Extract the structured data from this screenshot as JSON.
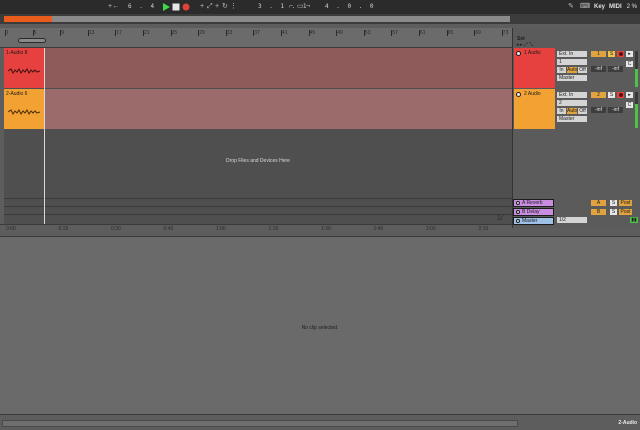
{
  "transport": {
    "tap_symbol": "+←",
    "position": "6 . 4 . 1",
    "loop_start": "3 . 1 . 1",
    "loop_length": "4 . 0 . 0",
    "key_label": "Key",
    "midi_label": "MIDI",
    "cpu": "2 %"
  },
  "ruler": {
    "bars": [
      "1",
      "5",
      "9",
      "13",
      "17",
      "21",
      "25",
      "29",
      "33",
      "37",
      "41",
      "45",
      "49",
      "53",
      "57",
      "61",
      "65",
      "69",
      "73"
    ]
  },
  "time_ruler": {
    "labels": [
      "0:00",
      "0:15",
      "0:30",
      "0:45",
      "1:00",
      "1:15",
      "1:30",
      "1:45",
      "2:00",
      "2:15"
    ],
    "left_marker": "1/"
  },
  "tracks": [
    {
      "clip_name": "1-Audio 8",
      "name": "1 Audio",
      "number": "1",
      "input_type": "Ext. In",
      "input_channel": "1",
      "output": "Master",
      "monitor": [
        "In",
        "Auto",
        "Off"
      ],
      "vol": "-inf",
      "pan": "-inf",
      "color": "#e6413f",
      "lane_color": "#8e5a5a"
    },
    {
      "clip_name": "2-Audio 6",
      "name": "2 Audio",
      "number": "2",
      "input_type": "Ext. In",
      "input_channel": "2",
      "output": "Master",
      "monitor": [
        "In",
        "Auto",
        "Off"
      ],
      "vol": "-inf",
      "pan": "-inf",
      "color": "#f2a233",
      "lane_color": "#9b6b6b"
    }
  ],
  "drop_hint": "Drop Files and Devices Here",
  "set_label": "Set",
  "returns": [
    {
      "name": "A Reverb",
      "letter": "A",
      "color": "#c88ce0"
    },
    {
      "name": "B Delay",
      "letter": "B",
      "color": "#c88ce0"
    }
  ],
  "master": {
    "name": "Master",
    "input": "1/2",
    "color": "#9ec0e6"
  },
  "return_buttons": {
    "solo": "S",
    "post": "Post"
  },
  "detail": {
    "message": "No clip selected."
  },
  "status": {
    "track_name": "2-Audio"
  }
}
